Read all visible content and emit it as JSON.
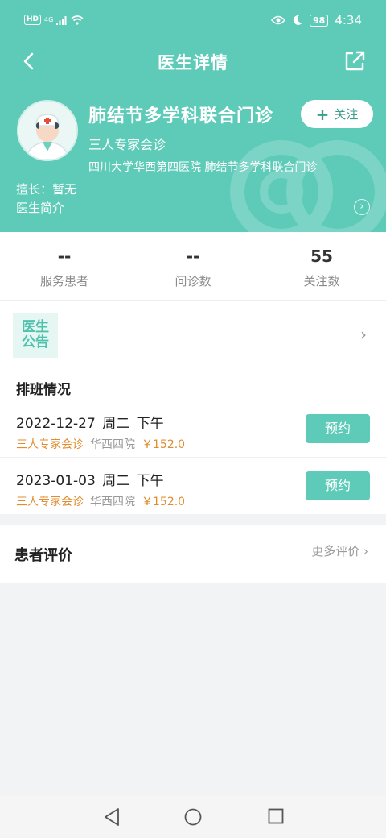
{
  "status_bar": {
    "hd": "HD",
    "network": "4G",
    "battery": "98",
    "time": "4:34"
  },
  "header": {
    "title": "医生详情"
  },
  "doctor": {
    "name": "肺结节多学科联合门诊",
    "type": "三人专家会诊",
    "hospital_dept": "四川大学华西第四医院  肺结节多学科联合门诊",
    "specialty": "擅长：暂无",
    "intro_label": "医生简介",
    "follow_plus": "+",
    "follow_label": "关注"
  },
  "stats": [
    {
      "value": "--",
      "label": "服务患者"
    },
    {
      "value": "--",
      "label": "问诊数"
    },
    {
      "value": "55",
      "label": "关注数"
    }
  ],
  "notice": {
    "line1": "医生",
    "line2": "公告"
  },
  "schedule": {
    "title": "排班情况",
    "rows": [
      {
        "date": "2022-12-27  周二  下午",
        "type": "三人专家会诊",
        "hospital": "华西四院",
        "price": "￥152.0",
        "button": "预约"
      },
      {
        "date": "2023-01-03  周二  下午",
        "type": "三人专家会诊",
        "hospital": "华西四院",
        "price": "￥152.0",
        "button": "预约"
      }
    ]
  },
  "reviews": {
    "title": "患者评价",
    "more_label": "更多评价"
  },
  "colors": {
    "primary": "#5ecbb8",
    "accent_orange": "#e08c2f",
    "text_gray": "#9a9a9a"
  },
  "icons": [
    "back-arrow-icon",
    "share-icon",
    "doctor-avatar-icon",
    "chevron-right-icon",
    "heart-watermark-icon",
    "nav-back-icon",
    "nav-home-icon",
    "nav-recent-icon"
  ]
}
